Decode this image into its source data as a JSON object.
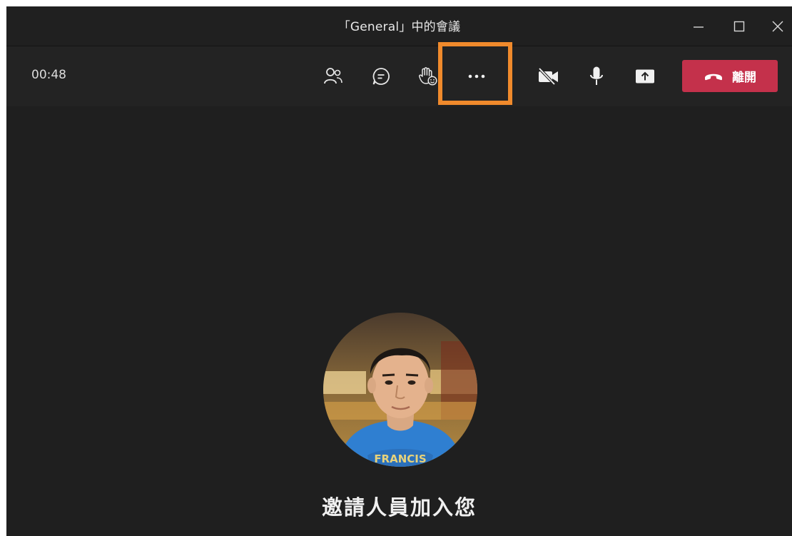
{
  "window": {
    "title": "「General」中的會議",
    "controls": [
      "minimize-icon",
      "maximize-icon",
      "close-icon"
    ]
  },
  "toolbar": {
    "timer": "00:48",
    "buttons": [
      "people-icon",
      "chat-icon",
      "raise-hand-icon",
      "more-options-icon",
      "camera-off-icon",
      "microphone-icon",
      "share-screen-icon"
    ],
    "leave_label": "離開",
    "leave_color": "#c4314b",
    "highlight_color": "#f08a2c"
  },
  "stage": {
    "invite_text": "邀請人員加入您"
  }
}
